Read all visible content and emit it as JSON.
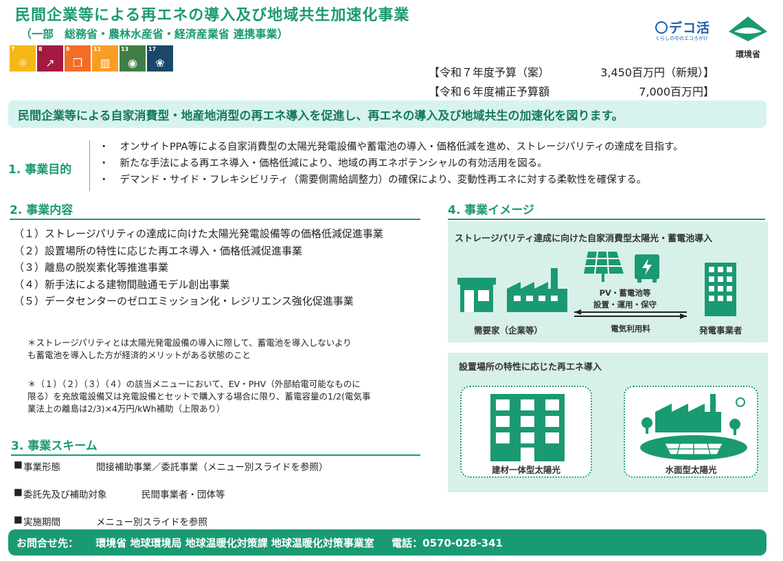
{
  "header": {
    "title": "民間企業等による再エネの導入及び地域共生加速化事業",
    "subtitle": "（一部　総務省・農林水産省・経済産業省 連携事業）"
  },
  "sdgs": [
    {
      "num": "7",
      "color": "#f7b718",
      "icon": "sun-icon"
    },
    {
      "num": "8",
      "color": "#a21942",
      "icon": "growth-chart-icon"
    },
    {
      "num": "9",
      "color": "#f36d25",
      "icon": "cubes-icon"
    },
    {
      "num": "11",
      "color": "#f99d26",
      "icon": "city-icon"
    },
    {
      "num": "13",
      "color": "#3f7e44",
      "icon": "eye-globe-icon"
    },
    {
      "num": "17",
      "color": "#19486a",
      "icon": "partnership-ring-icon"
    }
  ],
  "logos": {
    "decokatsu": "デコ活",
    "decokatsu_sub": "くらしの中のエコろがけ",
    "ministry": "環境省"
  },
  "budget": [
    {
      "label": "【令和７年度予算（案）",
      "value": "3,450百万円（新規）】"
    },
    {
      "label": "【令和６年度補正予算額",
      "value": "7,000百万円】"
    }
  ],
  "banner": "民間企業等による自家消費型・地産地消型の再エネ導入を促進し、再エネの導入及び地域共生の加速化を図ります。",
  "purpose": {
    "heading": "1. 事業目的",
    "items": [
      "オンサイトPPA等による自家消費型の太陽光発電設備や蓄電池の導入・価格低減を進め、ストレージパリティの達成を目指す。",
      "新たな手法による再エネ導入・価格低減により、地域の再エネポテンシャルの有効活用を図る。",
      "デマンド・サイド・フレキシビリティ（需要側需給調整力）の確保により、変動性再エネに対する柔軟性を確保する。"
    ]
  },
  "content": {
    "heading": "2. 事業内容",
    "items": [
      "（１）ストレージパリティの達成に向けた太陽光発電設備等の価格低減促進事業",
      "（２）設置場所の特性に応じた再エネ導入・価格低減促進事業",
      "（３）離島の脱炭素化等推進事業",
      "（４）新手法による建物間融通モデル創出事業",
      "（５）データセンターのゼロエミッション化・レジリエンス強化促進事業"
    ],
    "note1_line1": "＊ストレージパリティとは太陽光発電設備の導入に際して、蓄電池を導入しないより",
    "note1_line2": "も蓄電池を導入した方が経済的メリットがある状態のこと",
    "note2_line1": "＊（１）（２）（３）（４）の該当メニューにおいて、EV・PHV（外部給電可能なものに",
    "note2_line2": "限る）を充放電設備又は充電設備とセットで購入する場合に限り、蓄電容量の1/2(電気事",
    "note2_line3": "業法上の離島は2/3)×4万円/kWh補助（上限あり）"
  },
  "scheme": {
    "heading": "3. 事業スキーム",
    "rows": [
      {
        "bullet": "■",
        "key": "事業形態",
        "value": "間接補助事業／委託事業（メニュー別スライドを参照）"
      },
      {
        "bullet": "■",
        "key": "委託先及び補助対象",
        "value": "民間事業者・団体等"
      },
      {
        "bullet": "■",
        "key": "実施期間",
        "value": "メニュー別スライドを参照"
      }
    ]
  },
  "image": {
    "heading": "4. 事業イメージ",
    "panel1_title": "ストレージパリティ達成に向けた自家消費型太陽光・蓄電池導入",
    "pv_label_1": "PV・蓄電池等",
    "pv_label_2": "設置・運用・保守",
    "demand_label": "需要家（企業等）",
    "fee_label": "電気利用料",
    "supplier_label": "発電事業者",
    "panel2_title": "設置場所の特性に応じた再エネ導入",
    "bipv_label": "建材一体型太陽光",
    "floating_label": "水面型太陽光"
  },
  "footer": {
    "contact_label": "お問合せ先：",
    "office": "環境省 地球環境局 地球温暖化対策課 地球温暖化対策事業室",
    "phone": "電話：0570-028-341"
  },
  "colors": {
    "accent": "#1a9a72",
    "panel": "#d8f0ea",
    "banner": "#d8f3ef"
  }
}
